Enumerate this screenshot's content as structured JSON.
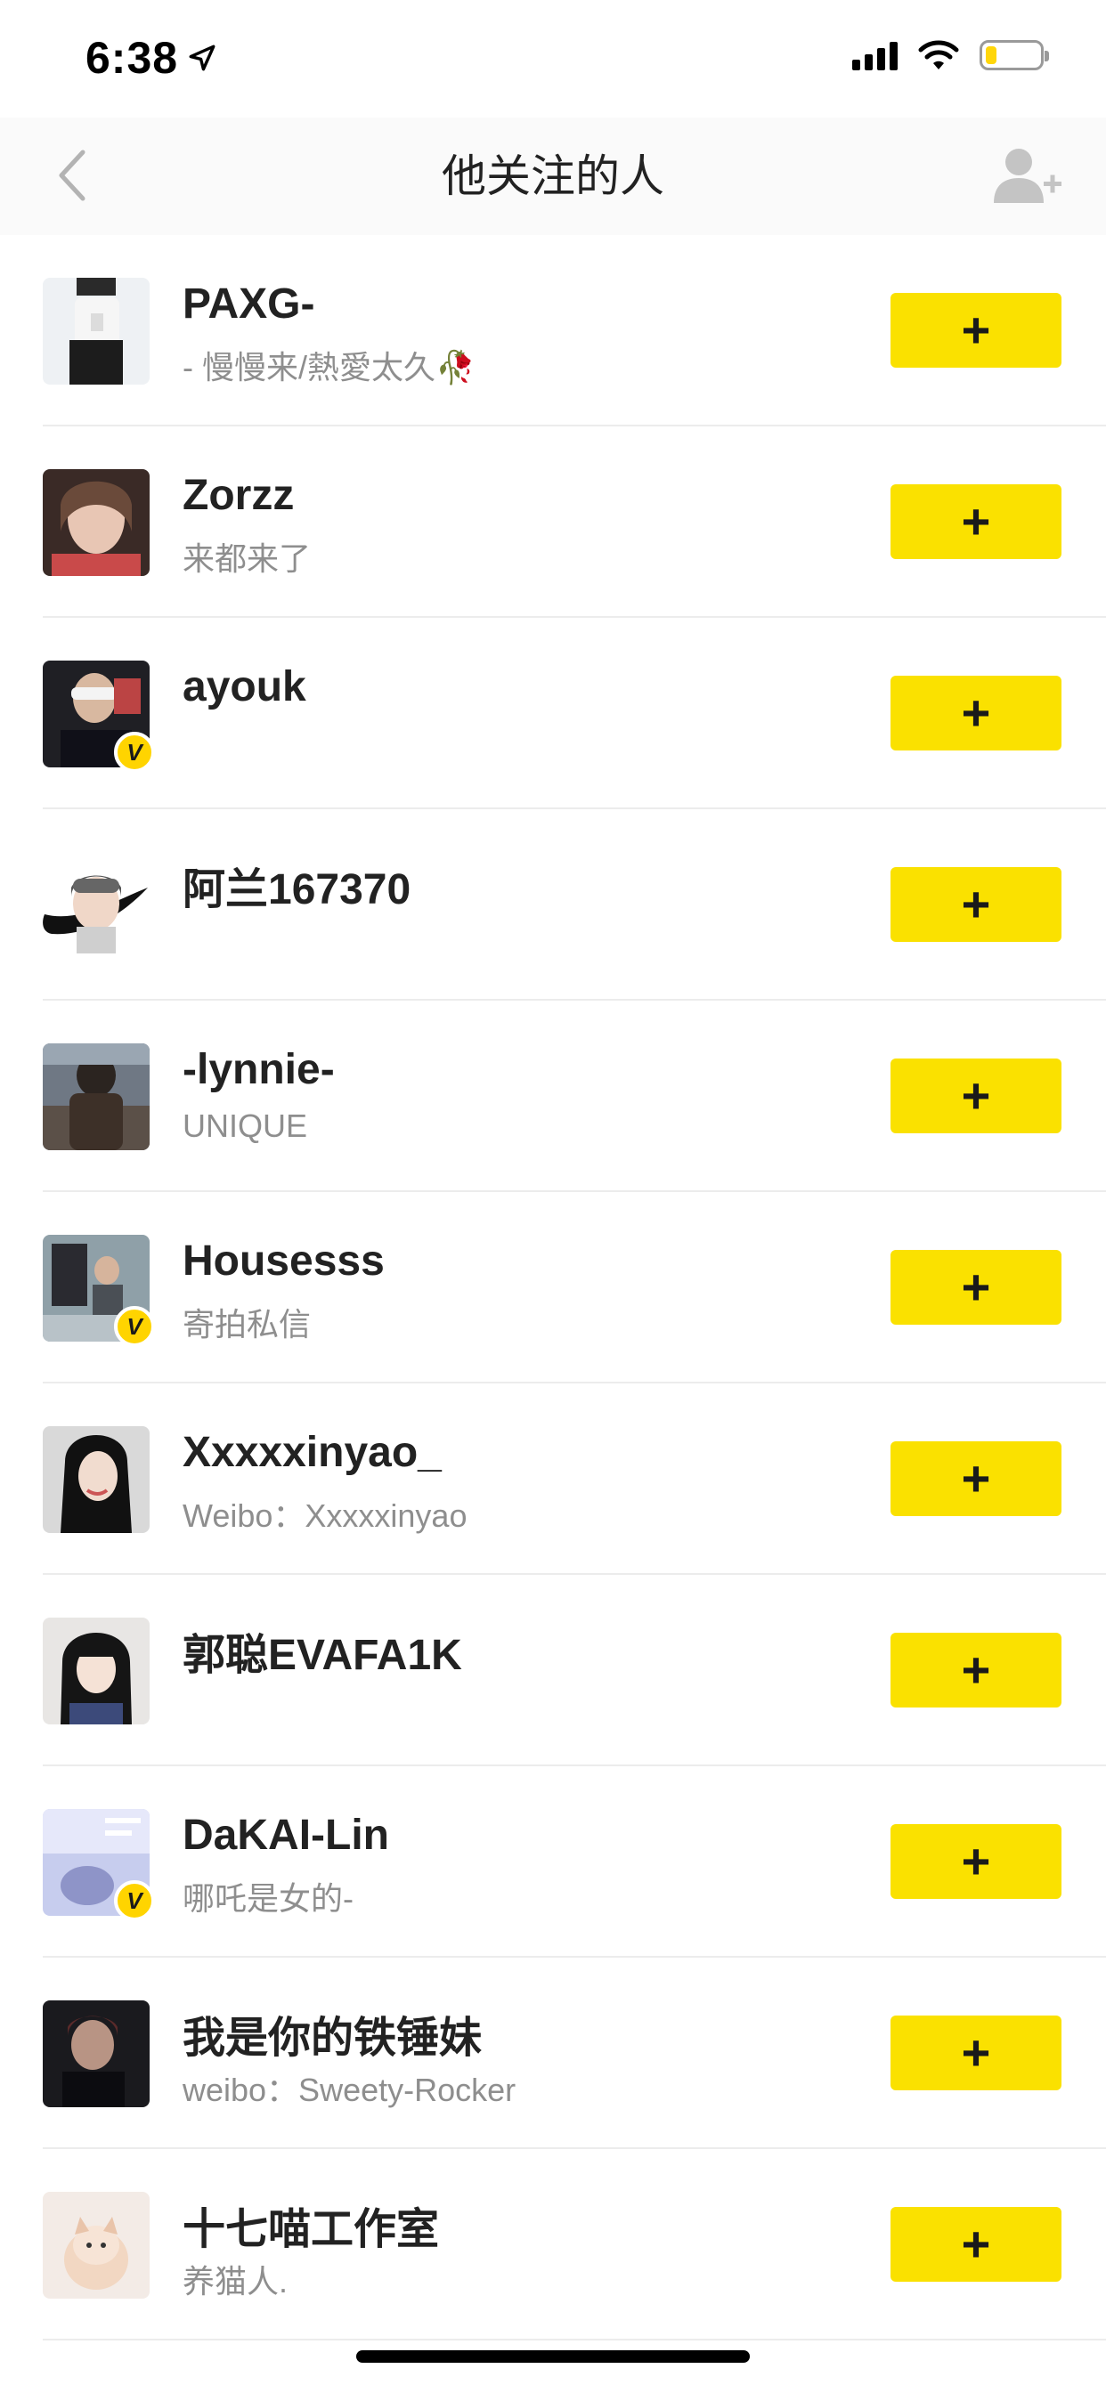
{
  "status_bar": {
    "time": "6:38",
    "location_icon": "location-arrow-icon",
    "signal_icon": "cellular-signal-icon",
    "wifi_icon": "wifi-icon",
    "battery_icon": "battery-icon",
    "battery_level": 0.2,
    "battery_color": "#ffd60a"
  },
  "nav": {
    "title": "他关注的人",
    "back_icon": "chevron-left-icon",
    "add_user_icon": "add-user-icon"
  },
  "accent_color": "#fae100",
  "users": [
    {
      "name": "PAXG-",
      "bio": "- 慢慢来/熱愛太久🥀",
      "verified": false
    },
    {
      "name": "Zorzz",
      "bio": "来都来了",
      "verified": false
    },
    {
      "name": "ayouk",
      "bio": "",
      "verified": true
    },
    {
      "name": "阿兰167370",
      "bio": "",
      "verified": false
    },
    {
      "name": "-lynnie-",
      "bio": "UNIQUE",
      "verified": false
    },
    {
      "name": "Housesss",
      "bio": "寄拍私信",
      "verified": true
    },
    {
      "name": "Xxxxxinyao_",
      "bio": "Weibo：Xxxxxinyao",
      "verified": false
    },
    {
      "name": "郭聪EVAFA1K",
      "bio": "",
      "verified": false
    },
    {
      "name": "DaKAI-Lin",
      "bio": "哪吒是女的-",
      "verified": true
    },
    {
      "name": "我是你的铁锤妹",
      "bio": "weibo：Sweety-Rocker",
      "verified": false
    },
    {
      "name": "十七喵工作室",
      "bio": "养猫人.",
      "verified": false
    }
  ],
  "follow_button_label": "+",
  "verified_badge_label": "V"
}
